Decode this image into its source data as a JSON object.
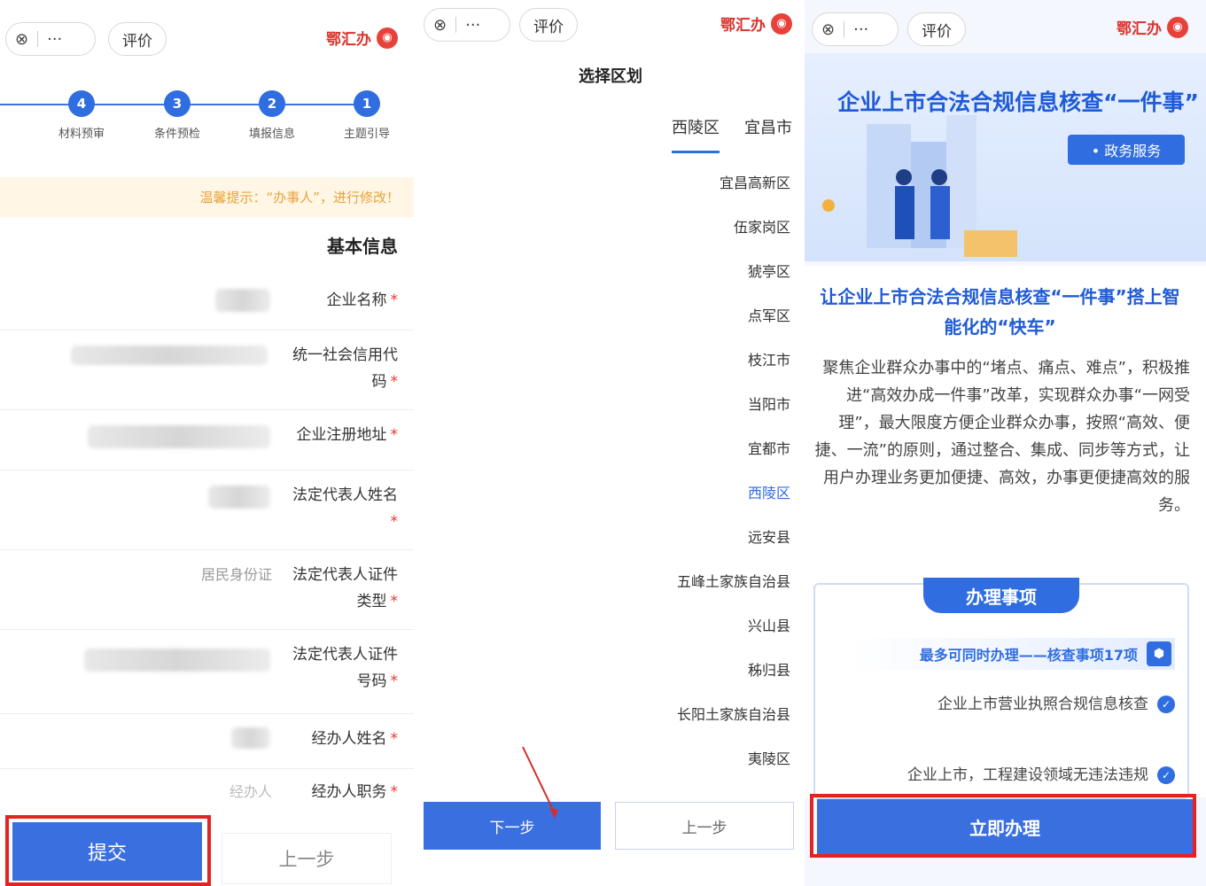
{
  "common": {
    "close_glyph": "⊗",
    "more_glyph": "···",
    "evaluate_label": "评价",
    "logo_text": "鄂汇办"
  },
  "panel1": {
    "steps": [
      {
        "num": "1",
        "label": "主题引导"
      },
      {
        "num": "2",
        "label": "填报信息"
      },
      {
        "num": "3",
        "label": "条件预检"
      },
      {
        "num": "4",
        "label": "材料预审"
      }
    ],
    "warning": "温馨提示：“办事人”，进行修改！",
    "section_title": "基本信息",
    "fields": [
      {
        "label": "企业名称",
        "value": ""
      },
      {
        "label": "统一社会信用代码",
        "value": ""
      },
      {
        "label": "企业注册地址",
        "value": ""
      },
      {
        "label": "法定代表人姓名",
        "value": ""
      },
      {
        "label": "法定代表人证件类型",
        "value": "居民身份证"
      },
      {
        "label": "法定代表人证件号码",
        "value": ""
      },
      {
        "label": "经办人姓名",
        "value": ""
      },
      {
        "label": "经办人职务",
        "value": "经办人"
      }
    ],
    "submit_label": "提交",
    "prev_label": "上一步"
  },
  "panel2": {
    "title": "选择区划",
    "tabs": [
      "宜昌市",
      "西陵区"
    ],
    "regions": [
      "宜昌高新区",
      "伍家岗区",
      "猇亭区",
      "点军区",
      "枝江市",
      "当阳市",
      "宜都市",
      "西陵区",
      "远安县",
      "五峰土家族自治县",
      "兴山县",
      "秭归县",
      "长阳土家族自治县",
      "夷陵区"
    ],
    "selected_region": "西陵区",
    "next_label": "下一步",
    "prev_label": "上一步"
  },
  "panel3": {
    "hero_title": "企业上市合法合规信息核查“一件事”",
    "hero_tag": "• 政务服务",
    "intro_heading": "让企业上市合法合规信息核查“一件事”搭上智能化的“快车”",
    "intro_text": "聚焦企业群众办事中的“堵点、痛点、难点”，积极推进“高效办成一件事”改革，实现群众办事“一网受理”，最大限度方便企业群众办事，按照“高效、便捷、一流”的原则，通过整合、集成、同步等方式，让用户办理业务更加便捷、高效，办事更便捷高效的服务。",
    "handle_title": "办理事项",
    "chain_text": "最多可同时办理——核查事项17项",
    "items": [
      "企业上市营业执照合规信息核查",
      "企业上市，工程建设领域无违法违规"
    ],
    "apply_label": "立即办理"
  },
  "colors": {
    "primary": "#3a6fe0",
    "highlight": "#e52222",
    "warning": "#e8a23a"
  }
}
